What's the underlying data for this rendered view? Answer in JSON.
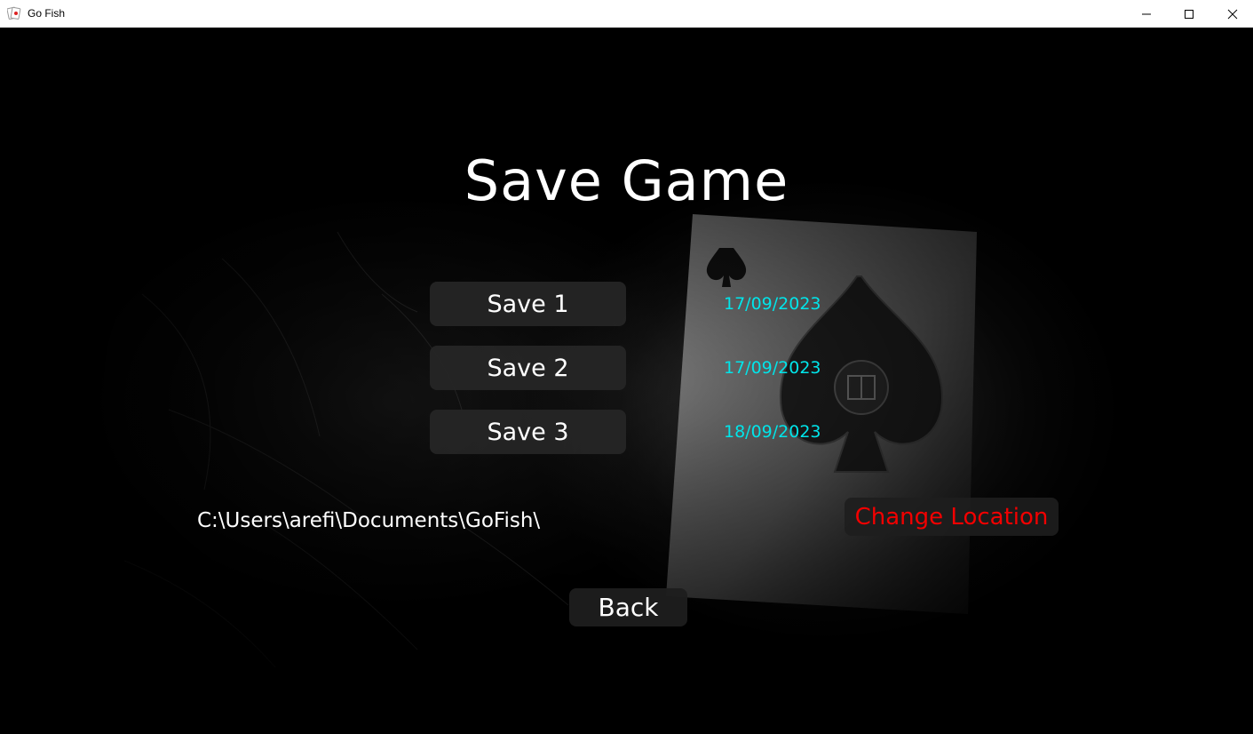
{
  "window": {
    "title": "Go Fish"
  },
  "screen": {
    "title": "Save Game"
  },
  "saves": [
    {
      "label": "Save 1",
      "date": "17/09/2023"
    },
    {
      "label": "Save 2",
      "date": "17/09/2023"
    },
    {
      "label": "Save 3",
      "date": "18/09/2023"
    }
  ],
  "location": {
    "path": "C:\\Users\\arefi\\Documents\\GoFish\\",
    "change_label": "Change Location"
  },
  "back_label": "Back",
  "icons": {
    "app": "playing-cards-icon",
    "minimize": "minimize-icon",
    "maximize": "maximize-icon",
    "close": "close-icon"
  },
  "colors": {
    "date": "#00e5ea",
    "change_location": "#f20000",
    "button_bg": "#262626"
  }
}
